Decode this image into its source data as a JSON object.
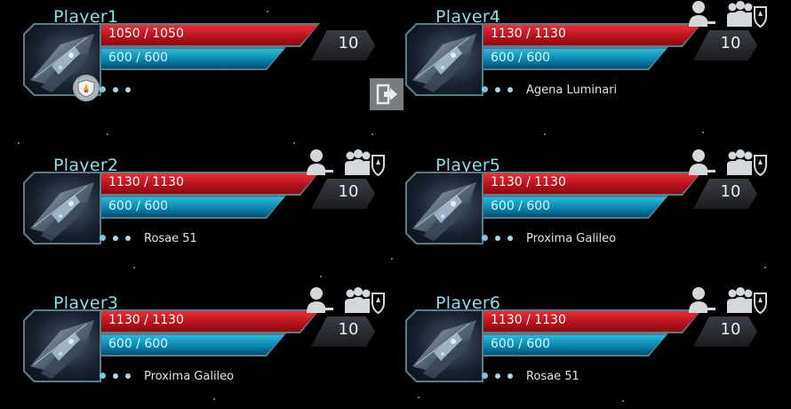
{
  "colors": {
    "name": "#8fdcec",
    "hp": "#d01822",
    "shield": "#0a9ac4",
    "frame": "#5a7c88"
  },
  "players": [
    {
      "name": "Player1",
      "hp": "1050 / 1050",
      "shield": "600 / 600",
      "level": "10",
      "location": "",
      "owner": true
    },
    {
      "name": "Player2",
      "hp": "1130 / 1130",
      "shield": "600 / 600",
      "level": "10",
      "location": "Rosae 51",
      "owner": false
    },
    {
      "name": "Player3",
      "hp": "1130 / 1130",
      "shield": "600 / 600",
      "level": "10",
      "location": "Proxima Galileo",
      "owner": false
    },
    {
      "name": "Player4",
      "hp": "1130 / 1130",
      "shield": "600 / 600",
      "level": "10",
      "location": "Agena Luminari",
      "owner": false
    },
    {
      "name": "Player5",
      "hp": "1130 / 1130",
      "shield": "600 / 600",
      "level": "10",
      "location": "Proxima Galileo",
      "owner": false
    },
    {
      "name": "Player6",
      "hp": "1130 / 1130",
      "shield": "600 / 600",
      "level": "10",
      "location": "Rosae 51",
      "owner": false
    }
  ],
  "icons": {
    "kick": "remove-player-icon",
    "party": "party-shield-icon",
    "leave": "leave-party-icon",
    "leader": "party-leader-badge-icon"
  }
}
